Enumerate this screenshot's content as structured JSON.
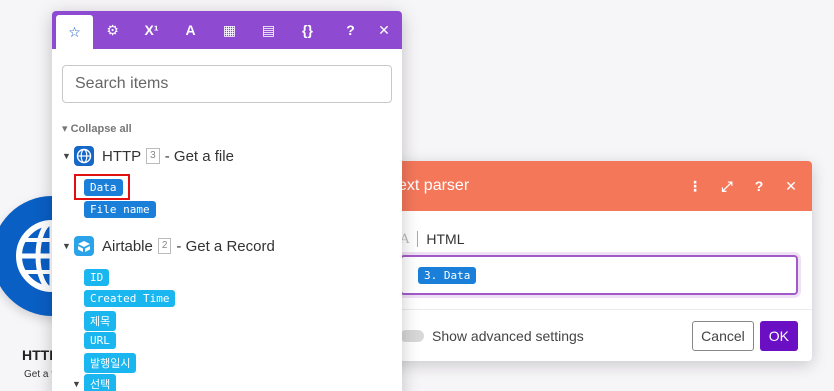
{
  "background_module": {
    "title": "HTTP",
    "subtitle": "Get a file"
  },
  "dialog": {
    "title": "Text parser",
    "field_label": "HTML",
    "field_value": "3. Data",
    "advanced_label": "Show advanced settings",
    "cancel_label": "Cancel",
    "ok_label": "OK",
    "header_color": "#f4775a",
    "ok_color": "#6a0fc4"
  },
  "panel": {
    "tabs": [
      {
        "icon": "star-icon",
        "glyph": "☆"
      },
      {
        "icon": "gear-icon",
        "glyph": "⚙"
      },
      {
        "icon": "superscript-icon",
        "glyph": "X¹"
      },
      {
        "icon": "text-icon",
        "glyph": "A"
      },
      {
        "icon": "calendar-icon",
        "glyph": "▦"
      },
      {
        "icon": "table-icon",
        "glyph": "▤"
      },
      {
        "icon": "braces-icon",
        "glyph": "{}"
      }
    ],
    "help_glyph": "?",
    "close_glyph": "✕",
    "search_placeholder": "Search items",
    "collapse_label": "Collapse all",
    "modules": [
      {
        "name": "HTTP",
        "number": "3",
        "action": "- Get a file",
        "items": [
          "Data",
          "File name"
        ]
      },
      {
        "name": "Airtable",
        "number": "2",
        "action": "- Get a Record",
        "items": [
          "ID",
          "Created Time",
          "제목",
          "URL",
          "발행일시",
          "선택"
        ]
      }
    ],
    "accent_color": "#8e4ad0"
  }
}
